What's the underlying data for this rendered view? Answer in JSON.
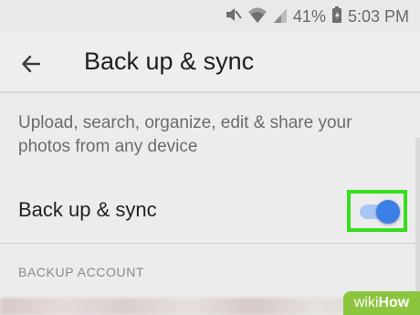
{
  "status_bar": {
    "battery": "41%",
    "time": "5:03 PM",
    "icons": [
      "mute-icon",
      "wifi-icon",
      "signal-icon",
      "battery-icon"
    ]
  },
  "app_bar": {
    "title": "Back up & sync",
    "back_icon": "arrow-left-icon"
  },
  "content": {
    "description": "Upload, search, organize, edit & share your photos from any device",
    "setting": {
      "label": "Back up & sync",
      "toggle_on": true
    },
    "section_header": "BACKUP ACCOUNT"
  },
  "colors": {
    "accent": "#3d7fe8",
    "track": "#a9c7f5",
    "highlight": "#34e01c"
  },
  "watermark": {
    "prefix": "wiki",
    "suffix": "How"
  }
}
